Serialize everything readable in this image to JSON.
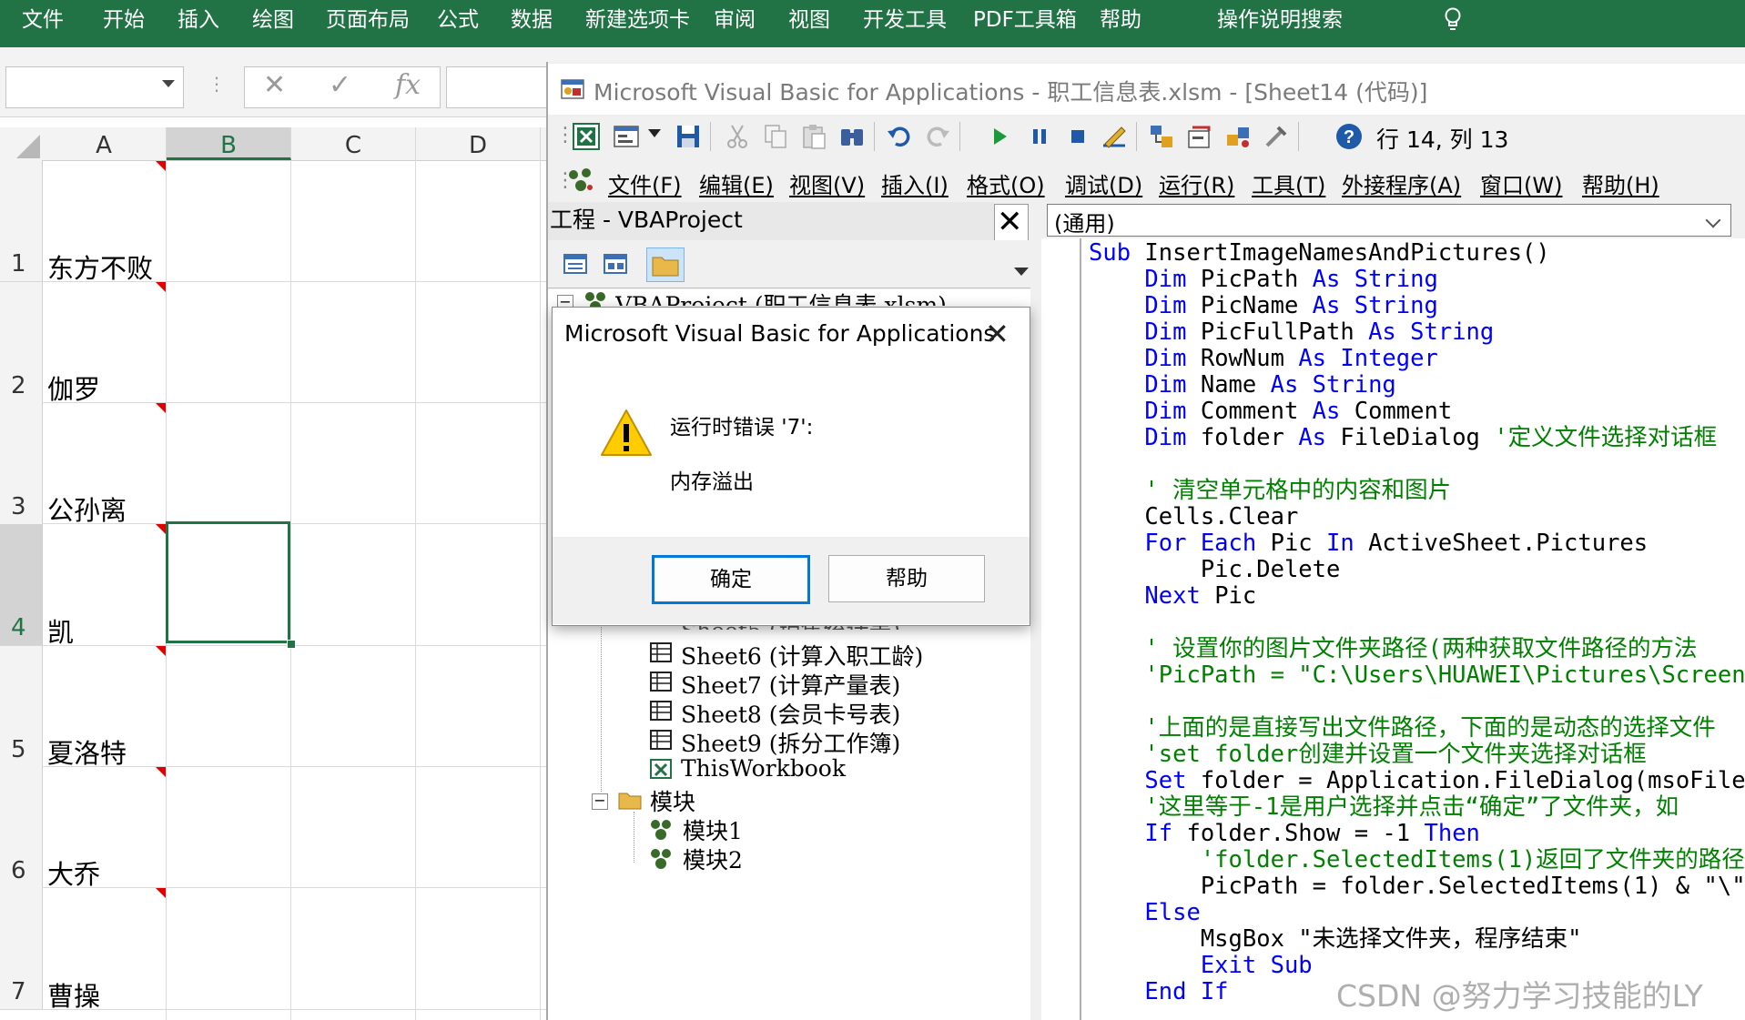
{
  "ribbon": {
    "tabs": [
      "文件",
      "开始",
      "插入",
      "绘图",
      "页面布局",
      "公式",
      "数据",
      "新建选项卡",
      "审阅",
      "视图",
      "开发工具",
      "PDF工具箱",
      "帮助"
    ],
    "search": "操作说明搜索"
  },
  "formula_bar": {
    "cancel": "✕",
    "enter": "✓",
    "fx": "fx"
  },
  "sheet": {
    "columns": [
      "A",
      "B",
      "C",
      "D"
    ],
    "rows": [
      "1",
      "2",
      "3",
      "4",
      "5",
      "6",
      "7"
    ],
    "cells": [
      "东方不败",
      "伽罗",
      "公孙离",
      "凯",
      "夏洛特",
      "大乔",
      "曹操"
    ]
  },
  "vbe": {
    "title": "Microsoft Visual Basic for Applications - 职工信息表.xlsm - [Sheet14 (代码)]",
    "cursor_status": "行 14,  列 13",
    "menus": [
      "文件(F)",
      "编辑(E)",
      "视图(V)",
      "插入(I)",
      "格式(O)",
      "调试(D)",
      "运行(R)",
      "工具(T)",
      "外接程序(A)",
      "窗口(W)",
      "帮助(H)"
    ],
    "project": {
      "title": "工程 - VBAProject",
      "close": "✕",
      "root": "VBAProject (职工信息表.xlsm)",
      "items_partial": "Sheet5 (销售统计表)",
      "items": [
        "Sheet6 (计算入职工龄)",
        "Sheet7 (计算产量表)",
        "Sheet8 (会员卡号表)",
        "Sheet9 (拆分工作簿)",
        "ThisWorkbook"
      ],
      "modules_folder": "模块",
      "modules": [
        "模块1",
        "模块2"
      ]
    },
    "code": {
      "combo": "(通用)",
      "lines": [
        {
          "indent": "",
          "parts": [
            {
              "t": "Sub ",
              "c": "kw"
            },
            {
              "t": "InsertImageNamesAndPictures()",
              "c": "tx"
            }
          ]
        },
        {
          "indent": "    ",
          "parts": [
            {
              "t": "Dim ",
              "c": "kw"
            },
            {
              "t": "PicPath ",
              "c": "tx"
            },
            {
              "t": "As String",
              "c": "kw"
            }
          ]
        },
        {
          "indent": "    ",
          "parts": [
            {
              "t": "Dim ",
              "c": "kw"
            },
            {
              "t": "PicName ",
              "c": "tx"
            },
            {
              "t": "As String",
              "c": "kw"
            }
          ]
        },
        {
          "indent": "    ",
          "parts": [
            {
              "t": "Dim ",
              "c": "kw"
            },
            {
              "t": "PicFullPath ",
              "c": "tx"
            },
            {
              "t": "As String",
              "c": "kw"
            }
          ]
        },
        {
          "indent": "    ",
          "parts": [
            {
              "t": "Dim ",
              "c": "kw"
            },
            {
              "t": "RowNum ",
              "c": "tx"
            },
            {
              "t": "As Integer",
              "c": "kw"
            }
          ]
        },
        {
          "indent": "    ",
          "parts": [
            {
              "t": "Dim ",
              "c": "kw"
            },
            {
              "t": "Name ",
              "c": "tx"
            },
            {
              "t": "As String",
              "c": "kw"
            }
          ]
        },
        {
          "indent": "    ",
          "parts": [
            {
              "t": "Dim ",
              "c": "kw"
            },
            {
              "t": "Comment ",
              "c": "tx"
            },
            {
              "t": "As ",
              "c": "kw"
            },
            {
              "t": "Comment",
              "c": "tx"
            }
          ]
        },
        {
          "indent": "    ",
          "parts": [
            {
              "t": "Dim ",
              "c": "kw"
            },
            {
              "t": "folder ",
              "c": "tx"
            },
            {
              "t": "As ",
              "c": "kw"
            },
            {
              "t": "FileDialog ",
              "c": "tx"
            },
            {
              "t": "'定义文件选择对话框",
              "c": "cm"
            }
          ]
        },
        {
          "indent": "",
          "parts": []
        },
        {
          "indent": "    ",
          "parts": [
            {
              "t": "' 清空单元格中的内容和图片",
              "c": "cm"
            }
          ]
        },
        {
          "indent": "    ",
          "parts": [
            {
              "t": "Cells.Clear",
              "c": "tx"
            }
          ]
        },
        {
          "indent": "    ",
          "parts": [
            {
              "t": "For Each ",
              "c": "kw"
            },
            {
              "t": "Pic ",
              "c": "tx"
            },
            {
              "t": "In ",
              "c": "kw"
            },
            {
              "t": "ActiveSheet.Pictures",
              "c": "tx"
            }
          ]
        },
        {
          "indent": "        ",
          "parts": [
            {
              "t": "Pic.Delete",
              "c": "tx"
            }
          ]
        },
        {
          "indent": "    ",
          "parts": [
            {
              "t": "Next ",
              "c": "kw"
            },
            {
              "t": "Pic",
              "c": "tx"
            }
          ]
        },
        {
          "indent": "",
          "parts": []
        },
        {
          "indent": "    ",
          "parts": [
            {
              "t": "' 设置你的图片文件夹路径(两种获取文件路径的方法",
              "c": "cm"
            }
          ]
        },
        {
          "indent": "    ",
          "parts": [
            {
              "t": "'PicPath = \"C:\\Users\\HUAWEI\\Pictures\\Screenshots",
              "c": "cm"
            }
          ]
        },
        {
          "indent": "",
          "parts": []
        },
        {
          "indent": "    ",
          "parts": [
            {
              "t": "'上面的是直接写出文件路径，下面的是动态的选择文件",
              "c": "cm"
            }
          ]
        },
        {
          "indent": "    ",
          "parts": [
            {
              "t": "'set folder创建并设置一个文件夹选择对话框",
              "c": "cm"
            }
          ]
        },
        {
          "indent": "    ",
          "parts": [
            {
              "t": "Set ",
              "c": "kw"
            },
            {
              "t": "folder = Application.FileDialog(msoFileDialog",
              "c": "tx"
            }
          ]
        },
        {
          "indent": "    ",
          "parts": [
            {
              "t": "'这里等于-1是用户选择并点击“确定”了文件夹，如",
              "c": "cm"
            }
          ]
        },
        {
          "indent": "    ",
          "parts": [
            {
              "t": "If ",
              "c": "kw"
            },
            {
              "t": "folder.Show = -1 ",
              "c": "tx"
            },
            {
              "t": "Then",
              "c": "kw"
            }
          ]
        },
        {
          "indent": "        ",
          "parts": [
            {
              "t": "'folder.SelectedItems(1)返回了文件夹的路径",
              "c": "cm"
            }
          ]
        },
        {
          "indent": "        ",
          "parts": [
            {
              "t": "PicPath = folder.SelectedItems(1) & \"\\\"",
              "c": "tx"
            }
          ]
        },
        {
          "indent": "    ",
          "parts": [
            {
              "t": "Else",
              "c": "kw"
            }
          ]
        },
        {
          "indent": "        ",
          "parts": [
            {
              "t": "MsgBox \"未选择文件夹，程序结束\"",
              "c": "tx"
            }
          ]
        },
        {
          "indent": "        ",
          "parts": [
            {
              "t": "Exit Sub",
              "c": "kw"
            }
          ]
        },
        {
          "indent": "    ",
          "parts": [
            {
              "t": "End If",
              "c": "kw"
            }
          ]
        }
      ]
    }
  },
  "dialog": {
    "title": "Microsoft Visual Basic for Applications",
    "close": "✕",
    "message_line1": "运行时错误 '7':",
    "message_line2": "内存溢出",
    "ok": "确定",
    "help": "帮助"
  },
  "watermark": "CSDN @努力学习技能的LY",
  "colors": {
    "ribbon": "#217346",
    "vba_keyword": "#0000ff",
    "vba_comment": "#008000",
    "vba_text": "#000000",
    "comment_indicator": "#e00000"
  }
}
